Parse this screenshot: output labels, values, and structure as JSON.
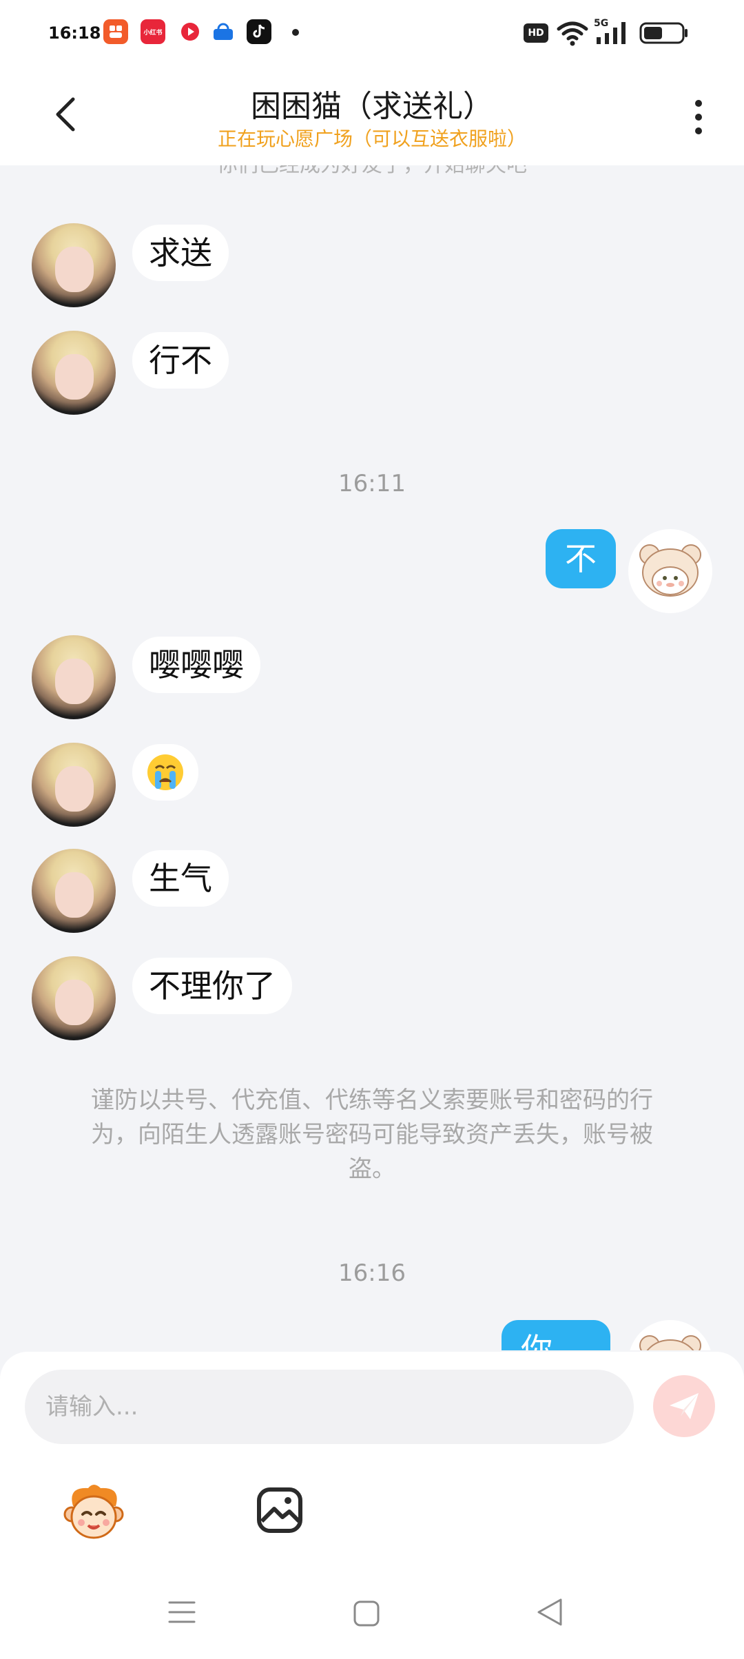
{
  "status_bar": {
    "time": "16:18",
    "apps": [
      {
        "icon": "kuaishou-app-icon",
        "color": "#f25b2a",
        "label": ""
      },
      {
        "icon": "xiaohongshu-app-icon",
        "color": "#e8263a",
        "label": "小红书"
      },
      {
        "icon": "video-app-icon",
        "color": "#ffffff",
        "label": ""
      },
      {
        "icon": "taobao-app-icon",
        "color": "#ffffff",
        "label": ""
      },
      {
        "icon": "tiktok-app-icon",
        "color": "#111111",
        "label": ""
      }
    ],
    "hd": "HD",
    "network": "5G",
    "battery_level": 0.5
  },
  "header": {
    "title": "困困猫（求送礼）",
    "subtitle": "正在玩心愿广场（可以互送衣服啦）",
    "subtitle_color": "#f0a11e"
  },
  "chat": {
    "system_clipped": "你们已经成为好友了，开始聊天吧",
    "messages": [
      {
        "from": "them",
        "text": "求送"
      },
      {
        "from": "them",
        "text": "行不"
      },
      {
        "from": "time",
        "text": "16:11"
      },
      {
        "from": "me",
        "text": "不"
      },
      {
        "from": "them",
        "text": "嘤嘤嘤"
      },
      {
        "from": "them",
        "text": "😭"
      },
      {
        "from": "them",
        "text": "生气"
      },
      {
        "from": "them",
        "text": "不理你了"
      },
      {
        "from": "system",
        "text": "谨防以共号、代充值、代练等名义索要账号和密码的行为，向陌生人透露账号密码可能导致资产丢失，账号被盗。"
      },
      {
        "from": "time",
        "text": "16:16"
      },
      {
        "from": "me",
        "text": "你"
      }
    ],
    "bubble_out_color": "#2db2f2"
  },
  "input": {
    "placeholder": "请输入..."
  }
}
